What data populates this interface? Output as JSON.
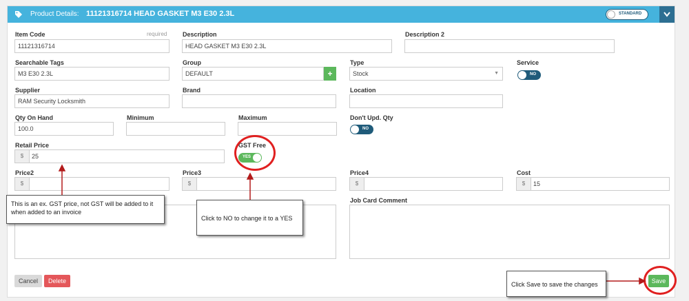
{
  "header": {
    "label": "Product Details:",
    "title": "11121316714 HEAD GASKET M3 E30 2.3L",
    "mode_toggle": "STANDARD"
  },
  "fields": {
    "item_code": {
      "label": "Item Code",
      "required": "required",
      "value": "11121316714"
    },
    "description": {
      "label": "Description",
      "value": "HEAD GASKET M3 E30 2.3L"
    },
    "description2": {
      "label": "Description 2",
      "value": ""
    },
    "searchable_tags": {
      "label": "Searchable Tags",
      "value": "M3 E30 2.3L"
    },
    "group": {
      "label": "Group",
      "value": "DEFAULT",
      "add": "+"
    },
    "type": {
      "label": "Type",
      "value": "Stock"
    },
    "service": {
      "label": "Service",
      "value": "NO"
    },
    "supplier": {
      "label": "Supplier",
      "value": "RAM Security Locksmith"
    },
    "brand": {
      "label": "Brand",
      "value": ""
    },
    "location": {
      "label": "Location",
      "value": ""
    },
    "qty_on_hand": {
      "label": "Qty On Hand",
      "value": "100.0"
    },
    "minimum": {
      "label": "Minimum",
      "value": ""
    },
    "maximum": {
      "label": "Maximum",
      "value": ""
    },
    "dont_upd_qty": {
      "label": "Don't Upd. Qty",
      "value": "NO"
    },
    "retail_price": {
      "label": "Retail Price",
      "currency": "$",
      "value": "25"
    },
    "gst_free": {
      "label": "GST Free",
      "value": "YES"
    },
    "price2": {
      "label": "Price2",
      "currency": "$",
      "value": ""
    },
    "price3": {
      "label": "Price3",
      "currency": "$",
      "value": ""
    },
    "price4": {
      "label": "Price4",
      "currency": "$",
      "value": ""
    },
    "cost": {
      "label": "Cost",
      "currency": "$",
      "value": "15"
    },
    "job_card_comment": {
      "label": "Job Card Comment",
      "value": ""
    }
  },
  "buttons": {
    "cancel": "Cancel",
    "delete": "Delete",
    "save": "Save"
  },
  "annotations": {
    "retail_note": "This is an ex. GST price, not GST will be added to it when added to an invoice",
    "gst_note": "Click to NO to change it to a YES",
    "save_note": "Click Save to save the changes"
  },
  "colors": {
    "header": "#45b3dd",
    "toggle_no": "#1f5b7a",
    "toggle_yes": "#5cb85c",
    "annotation": "#e02020",
    "highlight": "#fdfd4b"
  }
}
